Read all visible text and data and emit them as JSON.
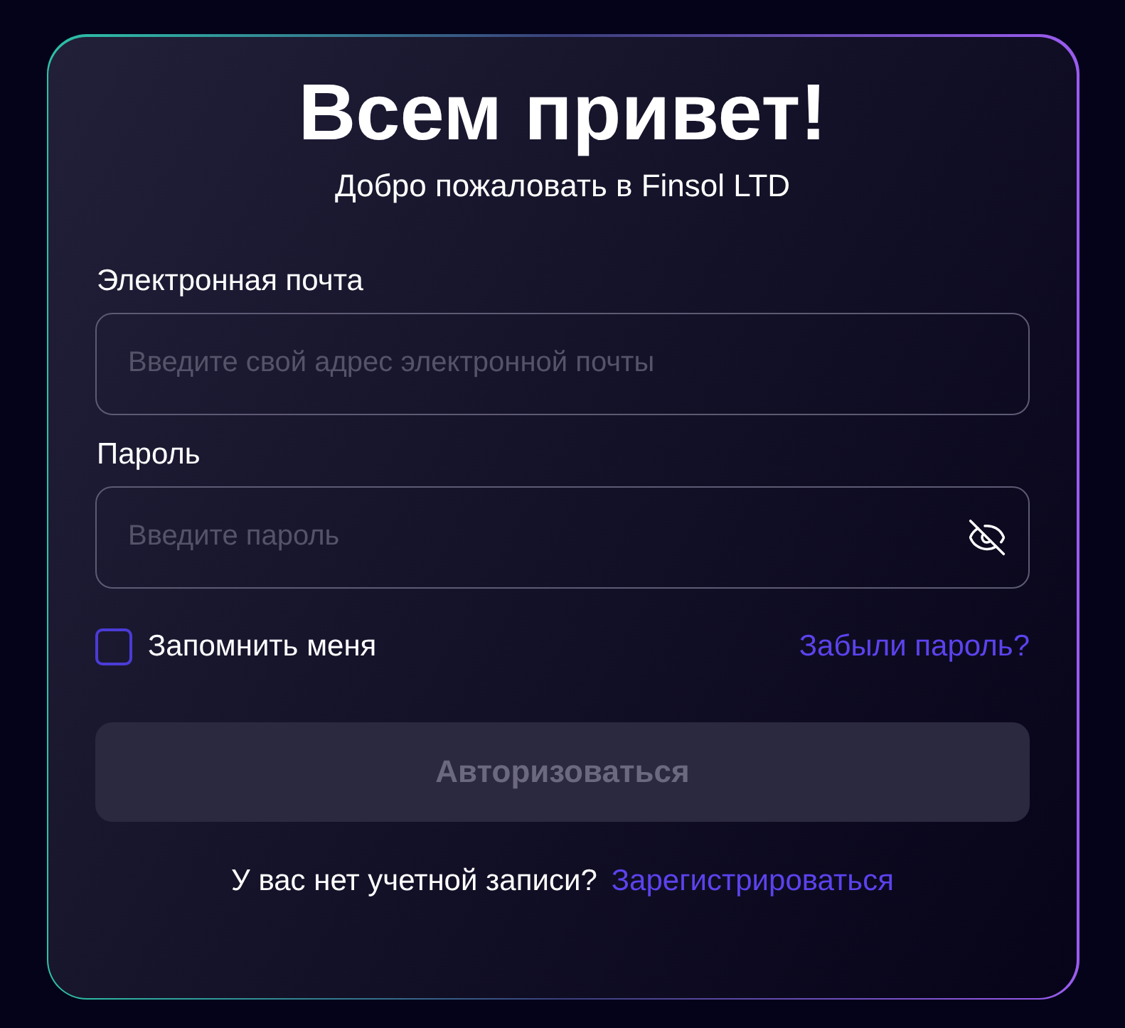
{
  "title": "Всем привет!",
  "subtitle": "Добро пожаловать в Finsol LTD",
  "fields": [
    {
      "label": "Электронная почта",
      "placeholder": "Введите свой адрес электронной почты",
      "kind": "text"
    },
    {
      "label": "Пароль",
      "placeholder": "Введите пароль",
      "kind": "password"
    }
  ],
  "remember": {
    "label": "Запомнить меня",
    "checked": false
  },
  "forgot_link": "Забыли пароль?",
  "submit": {
    "label": "Авторизоваться",
    "disabled": true
  },
  "signup": {
    "prompt": "У вас нет учетной записи?",
    "link": "Зарегистрироваться"
  }
}
